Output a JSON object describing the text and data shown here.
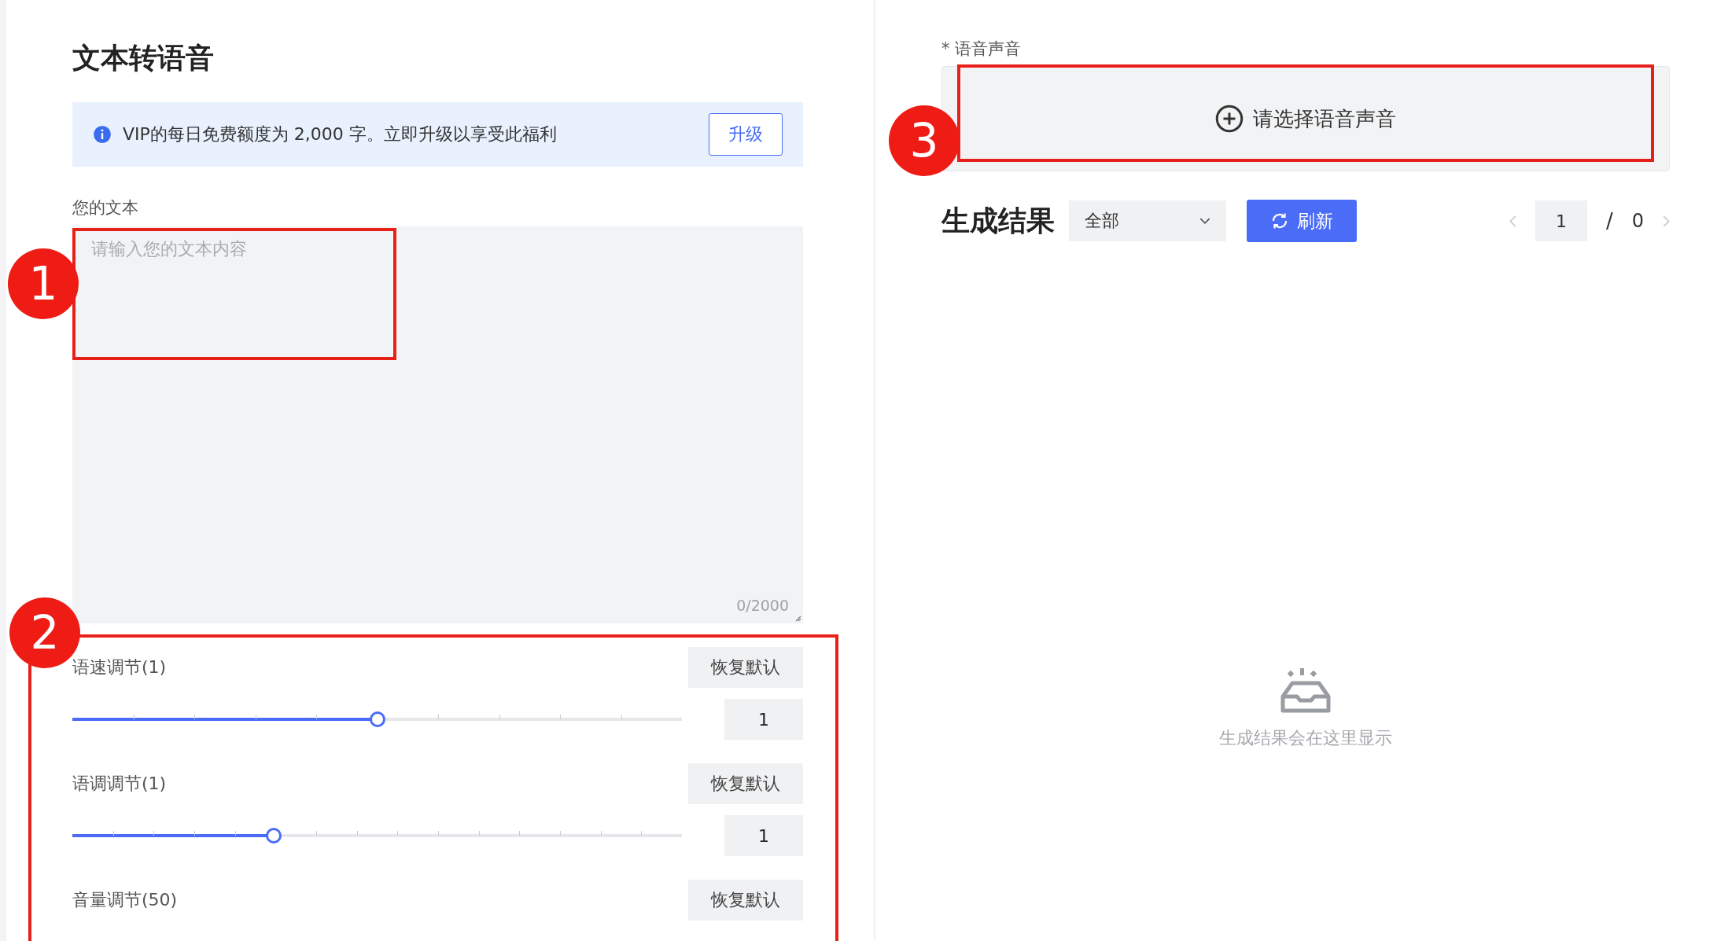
{
  "page_title": "文本转语音",
  "notice": {
    "text": "VIP的每日免费额度为 2,000 字。立即升级以享受此福利",
    "button": "升级"
  },
  "text_input": {
    "label": "您的文本",
    "placeholder": "请输入您的文本内容",
    "counter": "0/2000"
  },
  "sliders": [
    {
      "label": "语速调节(1)",
      "reset": "恢复默认",
      "level": 0.5,
      "value": "1"
    },
    {
      "label": "语调调节(1)",
      "reset": "恢复默认",
      "level": 0.33,
      "value": "1"
    },
    {
      "label": "音量调节(50)",
      "reset": "恢复默认"
    }
  ],
  "voice": {
    "label": "* 语音声音",
    "button": "请选择语音声音"
  },
  "results": {
    "title": "生成结果",
    "filter": "全部",
    "refresh": "刷新",
    "page": "1",
    "separator": "/",
    "total": "0",
    "empty": "生成结果会在这里显示"
  },
  "annotations": [
    {
      "label": "1"
    },
    {
      "label": "2"
    },
    {
      "label": "3"
    }
  ]
}
